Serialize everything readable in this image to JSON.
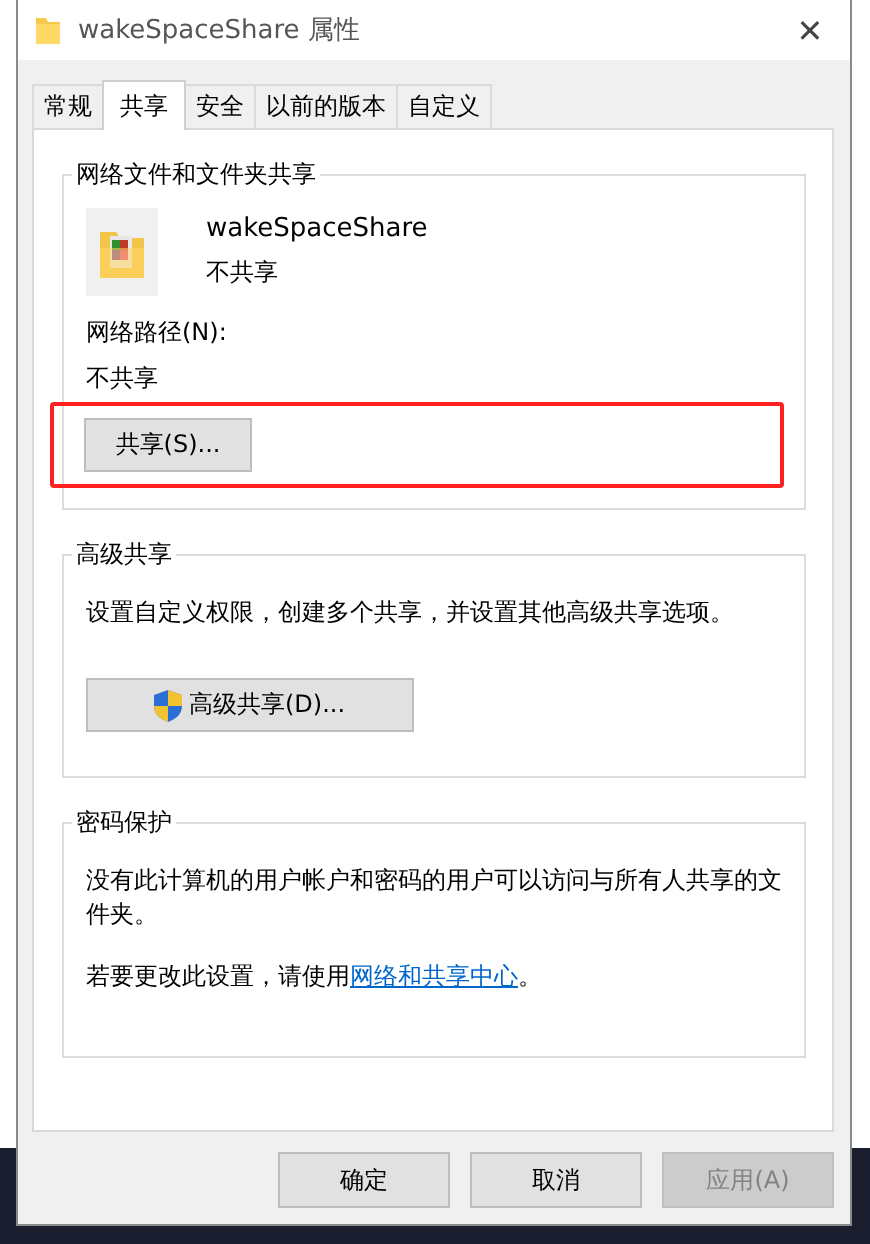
{
  "window": {
    "title": "wakeSpaceShare 属性",
    "close": "✕"
  },
  "tabs": [
    {
      "label": "常规",
      "selected": false
    },
    {
      "label": "共享",
      "selected": true
    },
    {
      "label": "安全",
      "selected": false
    },
    {
      "label": "以前的版本",
      "selected": false
    },
    {
      "label": "自定义",
      "selected": false
    }
  ],
  "network_sharing": {
    "title": "网络文件和文件夹共享",
    "folder_name": "wakeSpaceShare",
    "folder_status": "不共享",
    "path_label": "网络路径(N):",
    "path_value": "不共享",
    "share_button": {
      "label": "共享(S)...",
      "highlighted": true
    }
  },
  "advanced_sharing": {
    "title": "高级共享",
    "description": "设置自定义权限，创建多个共享，并设置其他高级共享选项。",
    "button": "高级共享(D)..."
  },
  "password_protection": {
    "title": "密码保护",
    "description": "没有此计算机的用户帐户和密码的用户可以访问与所有人共享的文件夹。",
    "change_text": "若要更改此设置，请使用",
    "link": "网络和共享中心",
    "change_end": "。"
  },
  "buttons": [
    {
      "label": "确定",
      "disabled": false
    },
    {
      "label": "取消",
      "disabled": false
    },
    {
      "label": "应用(A)",
      "disabled": true
    }
  ]
}
